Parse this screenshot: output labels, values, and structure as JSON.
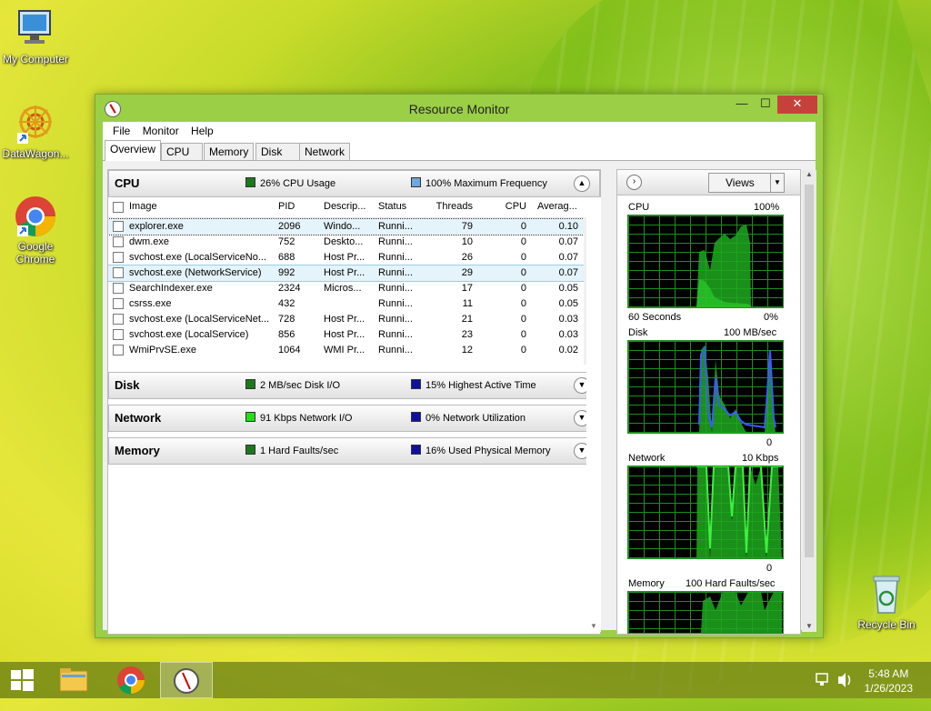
{
  "desktop": {
    "icons": [
      {
        "label": "My Computer"
      },
      {
        "label": "DataWagon..."
      },
      {
        "label": "Google Chrome"
      },
      {
        "label": "Recycle Bin"
      }
    ]
  },
  "window": {
    "title": "Resource Monitor",
    "controls": {
      "minimize": "—",
      "maximize": "☐",
      "close": "✕"
    },
    "menu": [
      "File",
      "Monitor",
      "Help"
    ],
    "tabs": [
      "Overview",
      "CPU",
      "Memory",
      "Disk",
      "Network"
    ],
    "active_tab": "Overview"
  },
  "cpu_section": {
    "name": "CPU",
    "stat1": "26% CPU Usage",
    "stat1_color": "#1a7a1a",
    "stat2": "100% Maximum Frequency",
    "stat2_color": "#6fa8dc",
    "expanded": true,
    "columns": [
      "Image",
      "PID",
      "Descrip...",
      "Status",
      "Threads",
      "CPU",
      "Averag..."
    ],
    "rows": [
      {
        "image": "explorer.exe",
        "pid": "2096",
        "desc": "Windo...",
        "status": "Runni...",
        "threads": "79",
        "cpu": "0",
        "avg": "0.10"
      },
      {
        "image": "dwm.exe",
        "pid": "752",
        "desc": "Deskto...",
        "status": "Runni...",
        "threads": "10",
        "cpu": "0",
        "avg": "0.07"
      },
      {
        "image": "svchost.exe (LocalServiceNo...",
        "pid": "688",
        "desc": "Host Pr...",
        "status": "Runni...",
        "threads": "26",
        "cpu": "0",
        "avg": "0.07"
      },
      {
        "image": "svchost.exe (NetworkService)",
        "pid": "992",
        "desc": "Host Pr...",
        "status": "Runni...",
        "threads": "29",
        "cpu": "0",
        "avg": "0.07"
      },
      {
        "image": "SearchIndexer.exe",
        "pid": "2324",
        "desc": "Micros...",
        "status": "Runni...",
        "threads": "17",
        "cpu": "0",
        "avg": "0.05"
      },
      {
        "image": "csrss.exe",
        "pid": "432",
        "desc": "",
        "status": "Runni...",
        "threads": "11",
        "cpu": "0",
        "avg": "0.05"
      },
      {
        "image": "svchost.exe (LocalServiceNet...",
        "pid": "728",
        "desc": "Host Pr...",
        "status": "Runni...",
        "threads": "21",
        "cpu": "0",
        "avg": "0.03"
      },
      {
        "image": "svchost.exe (LocalService)",
        "pid": "856",
        "desc": "Host Pr...",
        "status": "Runni...",
        "threads": "23",
        "cpu": "0",
        "avg": "0.03"
      },
      {
        "image": "WmiPrvSE.exe",
        "pid": "1064",
        "desc": "WMI Pr...",
        "status": "Runni...",
        "threads": "12",
        "cpu": "0",
        "avg": "0.02"
      }
    ]
  },
  "disk_section": {
    "name": "Disk",
    "stat1": "2 MB/sec Disk I/O",
    "stat1_color": "#1a7a1a",
    "stat2": "15% Highest Active Time",
    "stat2_color": "#1010a0"
  },
  "network_section": {
    "name": "Network",
    "stat1": "91 Kbps Network I/O",
    "stat1_color": "#22dd22",
    "stat2": "0% Network Utilization",
    "stat2_color": "#1010a0"
  },
  "memory_section": {
    "name": "Memory",
    "stat1": "1 Hard Faults/sec",
    "stat1_color": "#1a7a1a",
    "stat2": "16% Used Physical Memory",
    "stat2_color": "#1010a0"
  },
  "graphs_pane": {
    "views_label": "Views",
    "cpu": {
      "label": "CPU",
      "max": "100%",
      "bottom_left": "60 Seconds",
      "bottom_right": "0%"
    },
    "disk": {
      "label": "Disk",
      "max": "100 MB/sec",
      "bottom_right": "0"
    },
    "network": {
      "label": "Network",
      "max": "10 Kbps",
      "bottom_right": "0"
    },
    "memory": {
      "label": "Memory",
      "max": "100 Hard Faults/sec"
    }
  },
  "taskbar": {
    "time": "5:48 AM",
    "date": "1/26/2023"
  }
}
